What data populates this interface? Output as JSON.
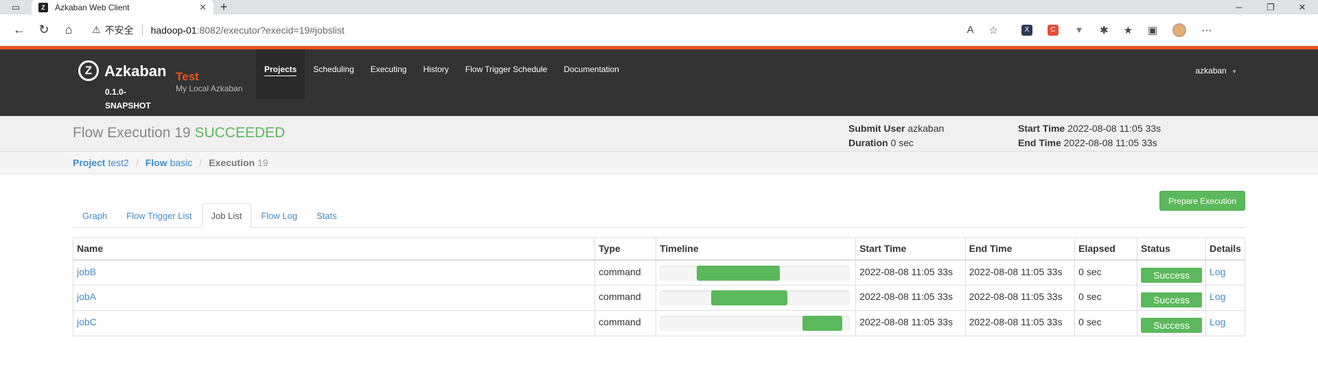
{
  "browser": {
    "tab_title": "Azkaban Web Client",
    "insecure_label": "不安全",
    "url_host": "hadoop-01",
    "url_path": ":8082/executor?execid=19#jobslist",
    "new_tab": "+",
    "win_min": "─",
    "win_max": "❐",
    "win_close": "✕"
  },
  "header": {
    "logo_name": "Azkaban",
    "version": "0.1.0-SNAPSHOT",
    "env_name": "Test",
    "env_desc": "My Local Azkaban",
    "nav": [
      {
        "label": "Projects",
        "active": true
      },
      {
        "label": "Scheduling"
      },
      {
        "label": "Executing"
      },
      {
        "label": "History"
      },
      {
        "label": "Flow Trigger Schedule"
      },
      {
        "label": "Documentation"
      }
    ],
    "user": "azkaban"
  },
  "flow": {
    "title_prefix": "Flow Execution 19",
    "status": "SUCCEEDED",
    "submit_user_label": "Submit User",
    "submit_user": "azkaban",
    "duration_label": "Duration",
    "duration": "0 sec",
    "start_time_label": "Start Time",
    "start_time": "2022-08-08 11:05 33s",
    "end_time_label": "End Time",
    "end_time": "2022-08-08 11:05 33s"
  },
  "breadcrumb": {
    "project_label": "Project",
    "project": "test2",
    "flow_label": "Flow",
    "flow": "basic",
    "execution_label": "Execution",
    "execution": "19"
  },
  "tabs": [
    "Graph",
    "Flow Trigger List",
    "Job List",
    "Flow Log",
    "Stats"
  ],
  "prepare_button": "Prepare Execution",
  "table": {
    "headers": [
      "Name",
      "Type",
      "Timeline",
      "Start Time",
      "End Time",
      "Elapsed",
      "Status",
      "Details"
    ],
    "rows": [
      {
        "name": "jobB",
        "type": "command",
        "start": "2022-08-08 11:05 33s",
        "end": "2022-08-08 11:05 33s",
        "elapsed": "0 sec",
        "status": "Success",
        "details": "Log",
        "timeline_start": 0.195,
        "timeline_end": 0.63
      },
      {
        "name": "jobA",
        "type": "command",
        "start": "2022-08-08 11:05 33s",
        "end": "2022-08-08 11:05 33s",
        "elapsed": "0 sec",
        "status": "Success",
        "details": "Log",
        "timeline_start": 0.27,
        "timeline_end": 0.67
      },
      {
        "name": "jobC",
        "type": "command",
        "start": "2022-08-08 11:05 33s",
        "end": "2022-08-08 11:05 33s",
        "elapsed": "0 sec",
        "status": "Success",
        "details": "Log",
        "timeline_start": 0.75,
        "timeline_end": 0.96
      }
    ]
  },
  "colors": {
    "accent": "#e8541f",
    "success": "#5cb85c",
    "link": "#428bca",
    "header_bg": "#333333"
  }
}
